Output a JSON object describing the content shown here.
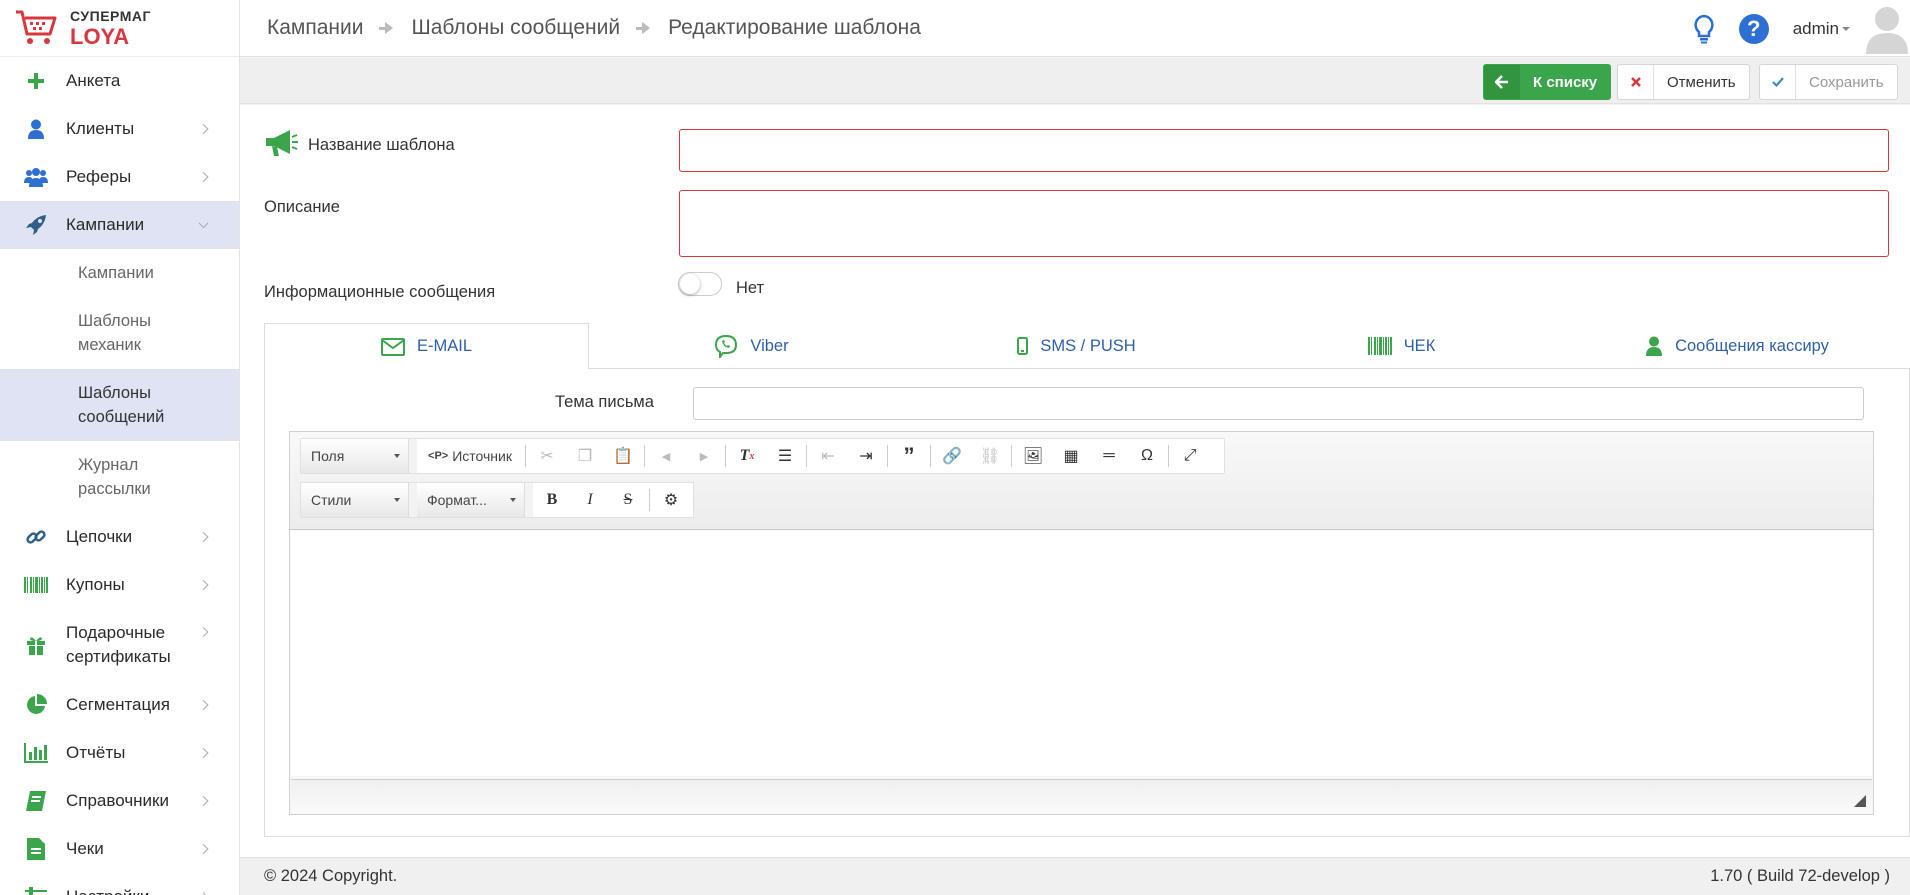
{
  "brand": {
    "line1": "СУПЕРМАГ",
    "line2": "LOYA",
    "color": "#d9363e"
  },
  "breadcrumb": [
    "Кампании",
    "Шаблоны сообщений",
    "Редактирование шаблона"
  ],
  "header": {
    "user": "admin"
  },
  "sidebar": {
    "items": [
      {
        "label": "Анкета",
        "icon": "plus-icon"
      },
      {
        "label": "Клиенты",
        "icon": "user-icon"
      },
      {
        "label": "Реферы",
        "icon": "users-icon"
      },
      {
        "label": "Кампании",
        "icon": "rocket-icon"
      },
      {
        "label": "Цепочки",
        "icon": "link-icon"
      },
      {
        "label": "Купоны",
        "icon": "barcode-icon"
      },
      {
        "label": "Подарочные сертификаты",
        "icon": "gift-icon"
      },
      {
        "label": "Сегментация",
        "icon": "pie-chart-icon"
      },
      {
        "label": "Отчёты",
        "icon": "bar-chart-icon"
      },
      {
        "label": "Справочники",
        "icon": "book-icon"
      },
      {
        "label": "Чеки",
        "icon": "document-icon"
      },
      {
        "label": "Настройки",
        "icon": "settings-icon"
      }
    ],
    "campaign_sub": [
      "Кампании",
      "Шаблоны механик",
      "Шаблоны сообщений",
      "Журнал рассылки"
    ]
  },
  "actions": {
    "back": "К списку",
    "cancel": "Отменить",
    "save": "Сохранить"
  },
  "form": {
    "name_label": "Название шаблона",
    "name_value": "",
    "description_label": "Описание",
    "description_value": "",
    "info_label": "Информационные сообщения",
    "info_state": "Нет"
  },
  "tabs": [
    {
      "label": "E-MAIL",
      "icon": "envelope-icon",
      "active": true
    },
    {
      "label": "Viber",
      "icon": "viber-icon",
      "active": false
    },
    {
      "label": "SMS / PUSH",
      "icon": "mobile-icon",
      "active": false
    },
    {
      "label": "ЧЕК",
      "icon": "barcode-icon",
      "active": false
    },
    {
      "label": "Сообщения кассиру",
      "icon": "user-icon",
      "active": false
    }
  ],
  "email": {
    "subject_label": "Тема письма",
    "subject_value": ""
  },
  "editor": {
    "fields_combo": "Поля",
    "source_button": "Источник",
    "styles_combo": "Стили",
    "format_combo": "Формат..."
  },
  "footer": {
    "copyright": "© 2024 Copyright.",
    "version": "1.70 ( Build 72-develop )"
  },
  "colors": {
    "accent_green": "#3aa54a",
    "link_blue": "#2e5fa8",
    "error_red": "#d9363e",
    "active_nav": "#dfe3f3"
  }
}
